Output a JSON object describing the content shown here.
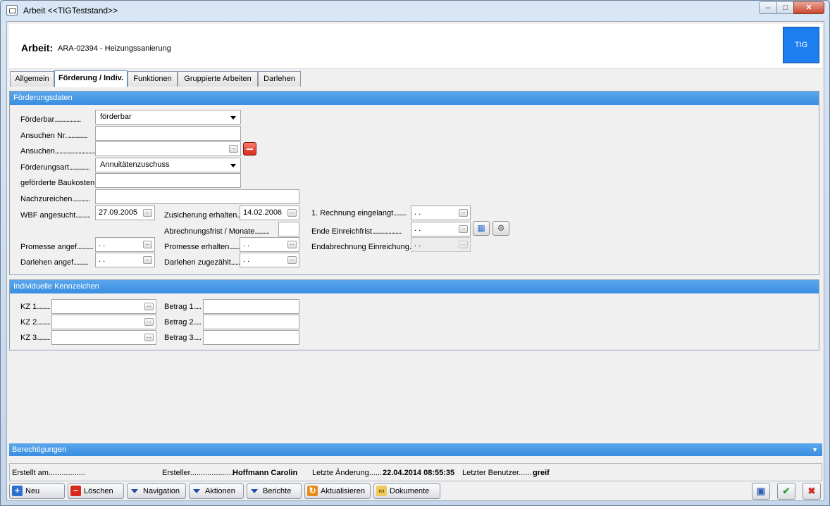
{
  "window": {
    "title": "Arbeit  <<TIGTeststand>>",
    "controls": {
      "min": "–",
      "max": "□",
      "close": "✕"
    }
  },
  "header": {
    "label": "Arbeit:",
    "value": "ARA-02394 - Heizungssanierung",
    "badge": "TIG",
    "badge_color": "#1d7ef0"
  },
  "tabs": [
    "Allgemein",
    "Förderung / Indiv.",
    "Funktionen",
    "Gruppierte Arbeiten",
    "Darlehen"
  ],
  "active_tab": "Förderung / Indiv.",
  "foerderungsdaten": {
    "title": "Förderungsdaten",
    "foerderbar": {
      "label": "Förderbar",
      "value": "förderbar"
    },
    "ansuchen_nr": {
      "label": "Ansuchen Nr.",
      "value": ""
    },
    "ansuchen": {
      "label": "Ansuchen",
      "value": ""
    },
    "foerderungsart": {
      "label": "Förderungsart",
      "value": "Annuitätenzuschuss"
    },
    "baukosten": {
      "label": "geförderte Baukosten",
      "value": ""
    },
    "nachzureichen": {
      "label": "Nachzureichen",
      "value": ""
    },
    "wbf_angesucht": {
      "label": "WBF angesucht",
      "value": "27.09.2005"
    },
    "zusicherung": {
      "label": "Zusicherung erhalten",
      "value": "14.02.2006"
    },
    "rechnung": {
      "label": "1. Rechnung eingelangt",
      "value": " .  ."
    },
    "abrechnungsfrist": {
      "label": "Abrechnungsfrist / Monate",
      "value": ""
    },
    "ende_einreichfrist": {
      "label": "Ende Einreichfrist",
      "value": " .  ."
    },
    "promesse_angef": {
      "label": "Promesse angef",
      "value": " .  ."
    },
    "promesse_erhalten": {
      "label": "Promesse erhalten",
      "value": " .  ."
    },
    "endabrechnung": {
      "label": "Endabrechnung Einreichung",
      "value": " .  ."
    },
    "darlehen_angef": {
      "label": "Darlehen angef",
      "value": " .  ."
    },
    "darlehen_zugezaehlt": {
      "label": "Darlehen zugezählt",
      "value": " .  ."
    }
  },
  "kennzeichen": {
    "title": "Individuelle Kennzeichen",
    "rows": [
      {
        "kz_label": "KZ 1",
        "kz_value": "",
        "betrag_label": "Betrag 1",
        "betrag_value": ""
      },
      {
        "kz_label": "KZ 2",
        "kz_value": "",
        "betrag_label": "Betrag 2",
        "betrag_value": ""
      },
      {
        "kz_label": "KZ 3",
        "kz_value": "",
        "betrag_label": "Betrag 3",
        "betrag_value": ""
      }
    ]
  },
  "berechtigungen": {
    "title": "Berechtigungen",
    "icon": "chevron-down-icon"
  },
  "status": {
    "erstellt_label": "Erstellt am",
    "erstellt_value": "",
    "ersteller_label": "Ersteller",
    "ersteller_value": "Hoffmann Carolin",
    "aenderung_label": "Letzte Änderung",
    "aenderung_value": "22.04.2014 08:55:35",
    "benutzer_label": "Letzter Benutzer",
    "benutzer_value": "greif"
  },
  "toolbar": {
    "neu": "Neu",
    "loeschen": "Löschen",
    "navigation": "Navigation",
    "aktionen": "Aktionen",
    "berichte": "Berichte",
    "aktualisieren": "Aktualisieren",
    "dokumente": "Dokumente"
  }
}
